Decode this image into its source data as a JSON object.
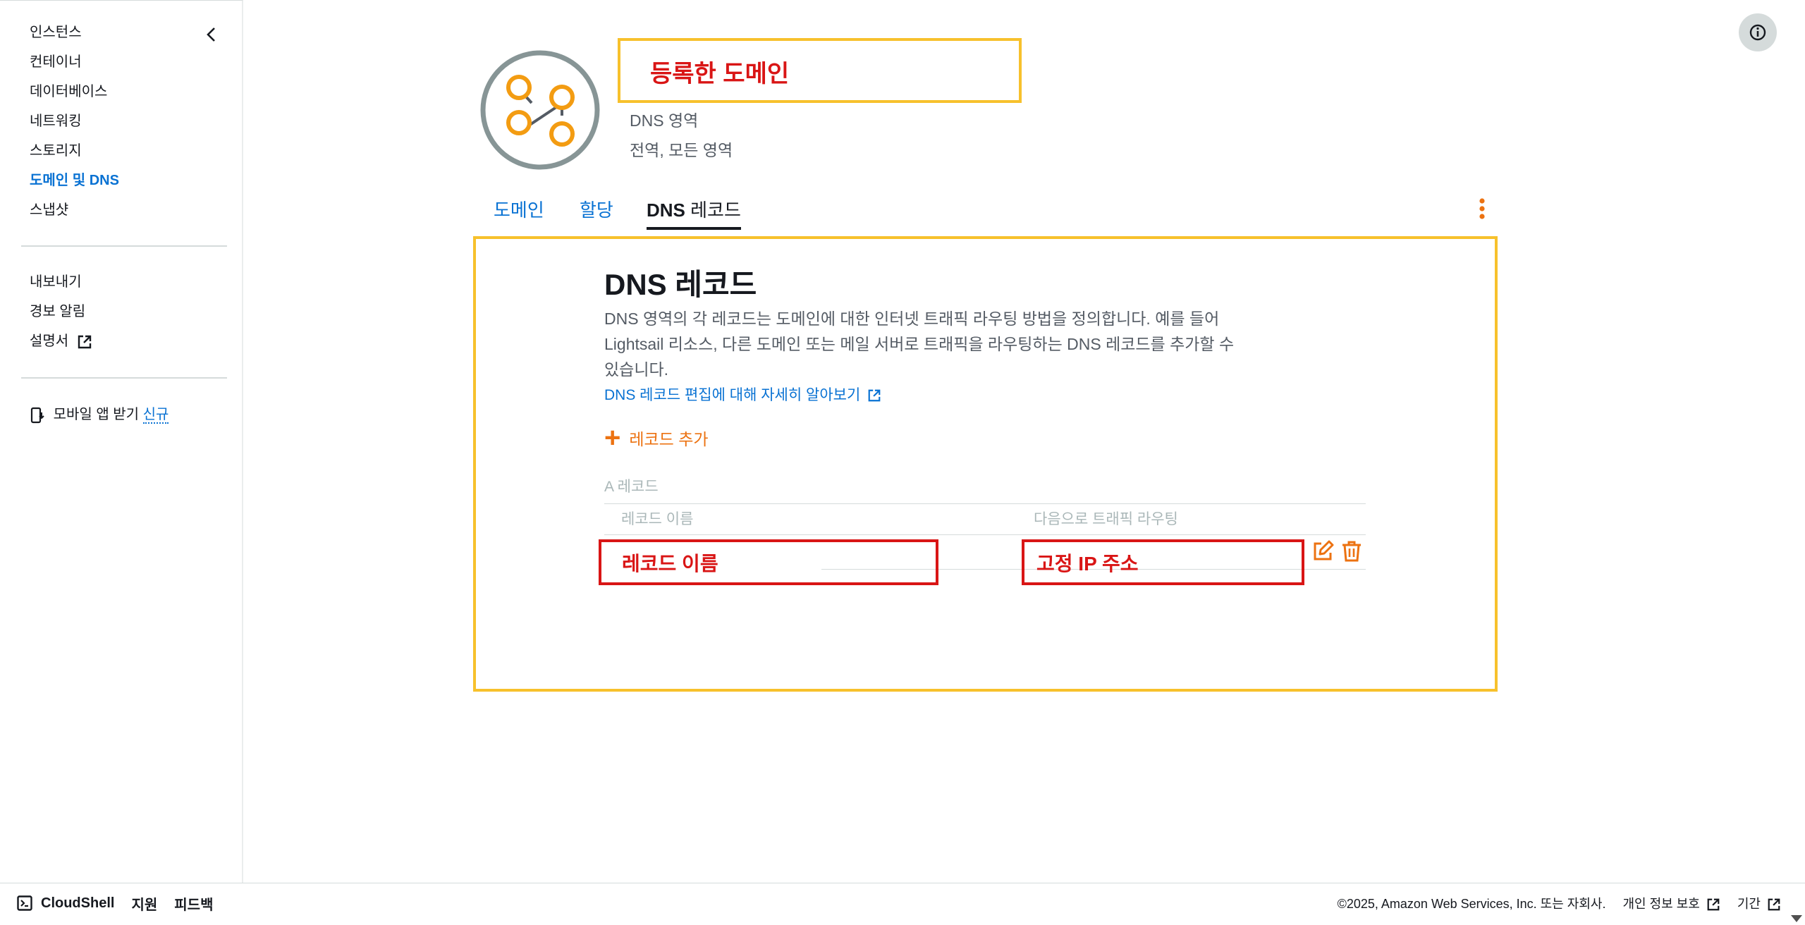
{
  "sidebar": {
    "items": [
      {
        "label": "인스턴스"
      },
      {
        "label": "컨테이너"
      },
      {
        "label": "데이터베이스"
      },
      {
        "label": "네트워킹"
      },
      {
        "label": "스토리지"
      },
      {
        "label": "도메인 및 DNS",
        "active": true
      },
      {
        "label": "스냅샷"
      }
    ],
    "secondary": [
      {
        "label": "내보내기"
      },
      {
        "label": "경보 알림"
      },
      {
        "label": "설명서"
      }
    ],
    "mobile_label": "모바일 앱 받기",
    "mobile_badge": "신규"
  },
  "header": {
    "domain_name": "등록한 도메인",
    "zone_type": "DNS 영역",
    "scope": "전역, 모든 영역"
  },
  "tabs": [
    {
      "label": "도메인"
    },
    {
      "label": "할당"
    },
    {
      "label_bold": "DNS",
      "label_rest": " 레코드",
      "active": true
    }
  ],
  "section": {
    "title_a": "DNS",
    "title_b": " 레코드",
    "description": "DNS 영역의 각 레코드는 도메인에 대한 인터넷 트래픽 라우팅 방법을 정의합니다. 예를 들어 Lightsail 리소스, 다른 도메인 또는 메일 서버로 트래픽을 라우팅하는 DNS 레코드를 추가할 수 있습니다.",
    "learn_link": "DNS 레코드 편집에 대해 자세히 알아보기",
    "add_record": "레코드 추가",
    "record_type_label": "A 레코드",
    "col_name": "레코드 이름",
    "col_route": "다음으로 트래픽 라우팅",
    "row": {
      "name": "레코드 이름",
      "target": "고정 IP 주소"
    }
  },
  "footer": {
    "cloudshell": "CloudShell",
    "support": "지원",
    "feedback": "피드백",
    "copyright": "©2025, Amazon Web Services, Inc. 또는 자회사.",
    "privacy": "개인 정보 보호",
    "terms": "기간"
  },
  "colors": {
    "accent": "#0972d3",
    "orange": "#ec7211",
    "highlight_yellow": "#f7c12c",
    "highlight_red": "#d91515"
  }
}
